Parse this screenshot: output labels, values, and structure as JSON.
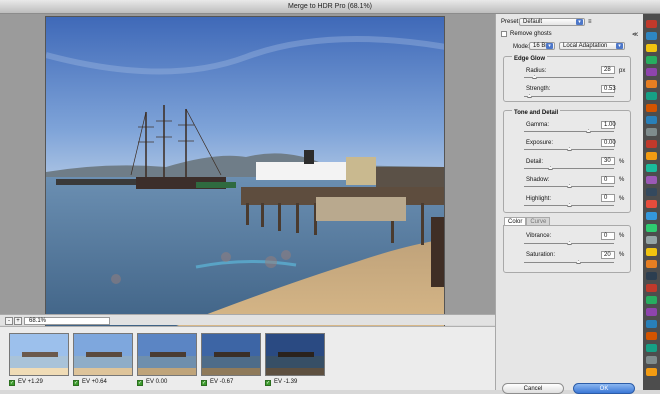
{
  "window": {
    "title": "Merge to HDR Pro (68.1%)"
  },
  "status": {
    "zoom_minus": "-",
    "zoom_plus": "+",
    "zoom": "68.1%"
  },
  "thumbnails": [
    {
      "label": "EV +1.29",
      "checked": true
    },
    {
      "label": "EV +0.64",
      "checked": true
    },
    {
      "label": "EV 0.00",
      "checked": true
    },
    {
      "label": "EV -0.67",
      "checked": true
    },
    {
      "label": "EV -1.39",
      "checked": true
    }
  ],
  "panel": {
    "preset_label": "Preset:",
    "preset_value": "Default",
    "preset_menu_icon": "≡",
    "remove_ghosts_label": "Remove ghosts",
    "remove_ghosts_checked": false,
    "collapse_icon": "≪",
    "mode_label": "Mode:",
    "mode_bits": "16 Bit",
    "mode_method": "Local Adaptation",
    "edge_glow": {
      "title": "Edge Glow",
      "radius_label": "Radius:",
      "radius_value": "28",
      "radius_unit": "px",
      "strength_label": "Strength:",
      "strength_value": "0.53"
    },
    "tone_detail": {
      "title": "Tone and Detail",
      "gamma_label": "Gamma:",
      "gamma_value": "1.00",
      "exposure_label": "Exposure:",
      "exposure_value": "0.00",
      "detail_label": "Detail:",
      "detail_value": "30",
      "detail_unit": "%",
      "shadow_label": "Shadow:",
      "shadow_value": "0",
      "shadow_unit": "%",
      "highlight_label": "Highlight:",
      "highlight_value": "0",
      "highlight_unit": "%"
    },
    "tabs": {
      "color": "Color",
      "curve": "Curve"
    },
    "color": {
      "vibrance_label": "Vibrance:",
      "vibrance_value": "0",
      "vibrance_unit": "%",
      "saturation_label": "Saturation:",
      "saturation_value": "20",
      "saturation_unit": "%"
    },
    "cancel_label": "Cancel",
    "ok_label": "OK"
  },
  "colors": {
    "accent": "#3b77d6",
    "sky": "#5c86c6",
    "water": "#587c9e",
    "sand": "#c9a774"
  }
}
